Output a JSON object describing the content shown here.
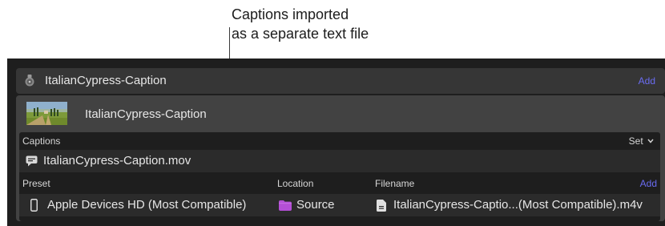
{
  "callout": {
    "line1": "Captions imported",
    "line2": "as a separate text file"
  },
  "job": {
    "title": "ItalianCypress-Caption",
    "add_label": "Add",
    "icon": "compressor-app-icon"
  },
  "source_file": {
    "title": "ItalianCypress-Caption",
    "thumbnail": "cypress-landscape-thumbnail"
  },
  "captions": {
    "section_label": "Captions",
    "set_label": "Set",
    "set_icon": "chevron-down-icon",
    "file_name": "ItalianCypress-Caption.mov",
    "file_icon": "caption-icon"
  },
  "outputs": {
    "columns": {
      "preset": "Preset",
      "location": "Location",
      "filename": "Filename"
    },
    "add_label": "Add",
    "rows": [
      {
        "preset": "Apple Devices HD (Most Compatible)",
        "preset_icon": "phone-icon",
        "location": "Source",
        "location_icon": "folder-icon",
        "filename": "ItalianCypress-Captio...(Most Compatible).m4v",
        "filename_icon": "document-icon"
      }
    ]
  },
  "colors": {
    "accent": "#6a6cf2",
    "folder": "#b44fd6",
    "panel_bg": "#1e1e1e",
    "header_bg": "#363636",
    "file_block_bg": "#424242"
  }
}
